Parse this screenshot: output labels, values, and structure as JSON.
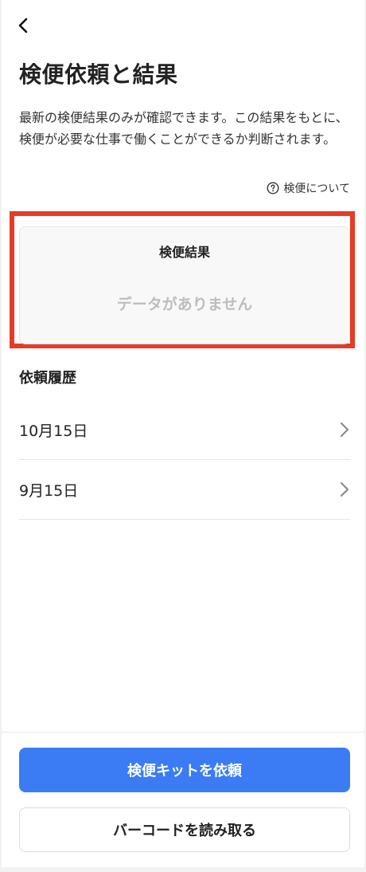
{
  "header": {
    "back_icon": "chevron-left-icon",
    "title": "検便依頼と結果",
    "description": "最新の検便結果のみが確認できます。この結果をもとに、検便が必要な仕事で働くことができるか判断されます。",
    "about_link": "検便について",
    "about_icon": "help-circle-icon"
  },
  "result_card": {
    "title": "検便結果",
    "empty_message": "データがありません",
    "highlight_color": "#e63b25"
  },
  "history": {
    "title": "依頼履歴",
    "items": [
      {
        "date": "10月15日",
        "icon": "chevron-right-icon"
      },
      {
        "date": "9月15日",
        "icon": "chevron-right-icon"
      }
    ]
  },
  "footer": {
    "primary_button": "検便キットを依頼",
    "secondary_button": "バーコードを読み取る",
    "primary_color": "#3b7cf5"
  }
}
